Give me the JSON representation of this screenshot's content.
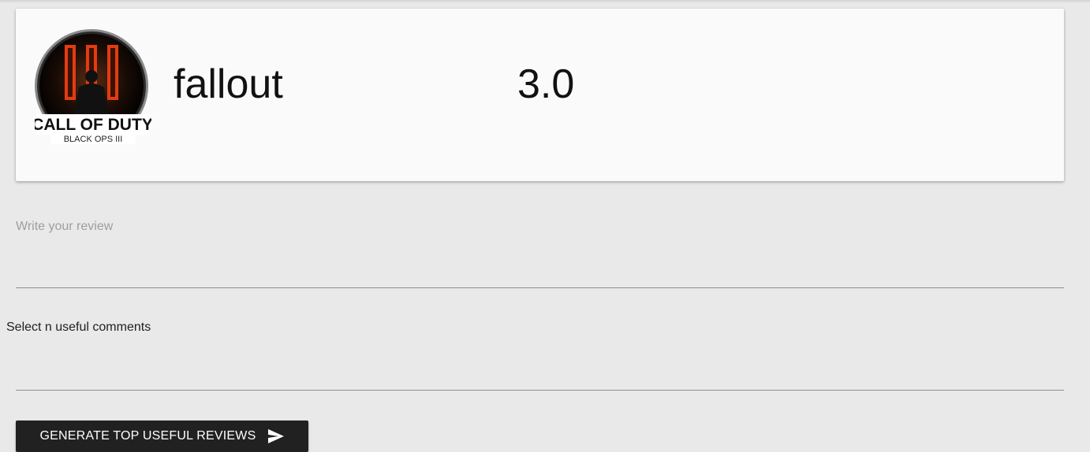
{
  "game": {
    "title": "fallout",
    "rating": "3.0",
    "logo": {
      "icon": "call-of-duty-black-ops-3-logo",
      "line1": "CALL OF DUTY",
      "line2": "BLACK OPS III"
    }
  },
  "review": {
    "placeholder": "Write your review",
    "value": ""
  },
  "comments": {
    "label": "Select n useful comments",
    "value": ""
  },
  "generate_button": {
    "label": "GENERATE TOP USEFUL REVIEWS",
    "icon": "send-icon"
  },
  "colors": {
    "background": "#e9e9e9",
    "card": "#fafafa",
    "button": "#212121",
    "logo_accent": "#e23c12"
  }
}
